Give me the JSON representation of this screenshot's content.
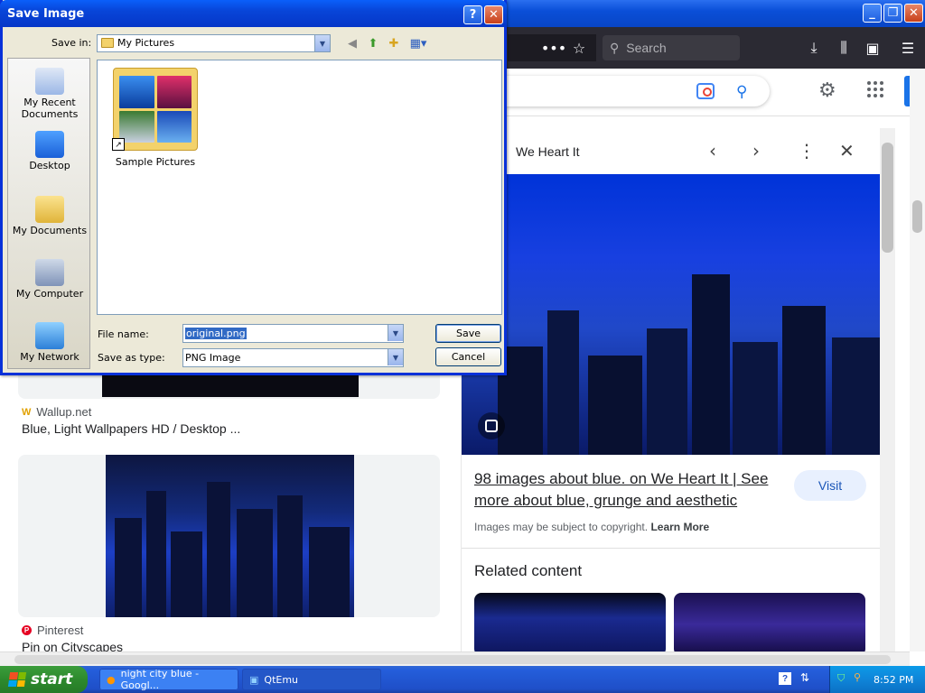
{
  "browser": {
    "search_placeholder": "Search",
    "toolbar_icons": [
      "more-dots-icon",
      "bookmark-star-icon",
      "download-icon",
      "library-icon",
      "sidebar-icon",
      "menu-icon"
    ]
  },
  "google": {
    "icons": [
      "lens-icon",
      "search-icon",
      "settings-gear-icon",
      "apps-grid-icon"
    ]
  },
  "results": [
    {
      "source": "Wallup.net",
      "title": "Blue, Light Wallpapers HD / Desktop ..."
    },
    {
      "source": "Pinterest",
      "title": "Pin on Cityscapes"
    }
  ],
  "panel": {
    "source": "We Heart It",
    "title": "98 images about blue. on We Heart It | See more about blue, grunge and aesthetic",
    "visit_label": "Visit",
    "copyright_text": "Images may be subject to copyright.",
    "learn_more": "Learn More",
    "related_heading": "Related content"
  },
  "dialog": {
    "title": "Save Image",
    "save_in_label": "Save in:",
    "save_in_value": "My Pictures",
    "places": [
      "My Recent Documents",
      "Desktop",
      "My Documents",
      "My Computer",
      "My Network"
    ],
    "folder_item": "Sample Pictures",
    "file_name_label": "File name:",
    "file_name_value": "original.png",
    "save_as_type_label": "Save as type:",
    "save_as_type_value": "PNG Image",
    "save_button": "Save",
    "cancel_button": "Cancel"
  },
  "taskbar": {
    "start_label": "start",
    "tasks": [
      "night city blue - Googl...",
      "QtEmu"
    ],
    "clock": "8:52 PM"
  },
  "colors": {
    "xp_blue": "#0a5ffa",
    "firefox_toolbar": "#2b2a33",
    "google_blue": "#1a73e8"
  }
}
